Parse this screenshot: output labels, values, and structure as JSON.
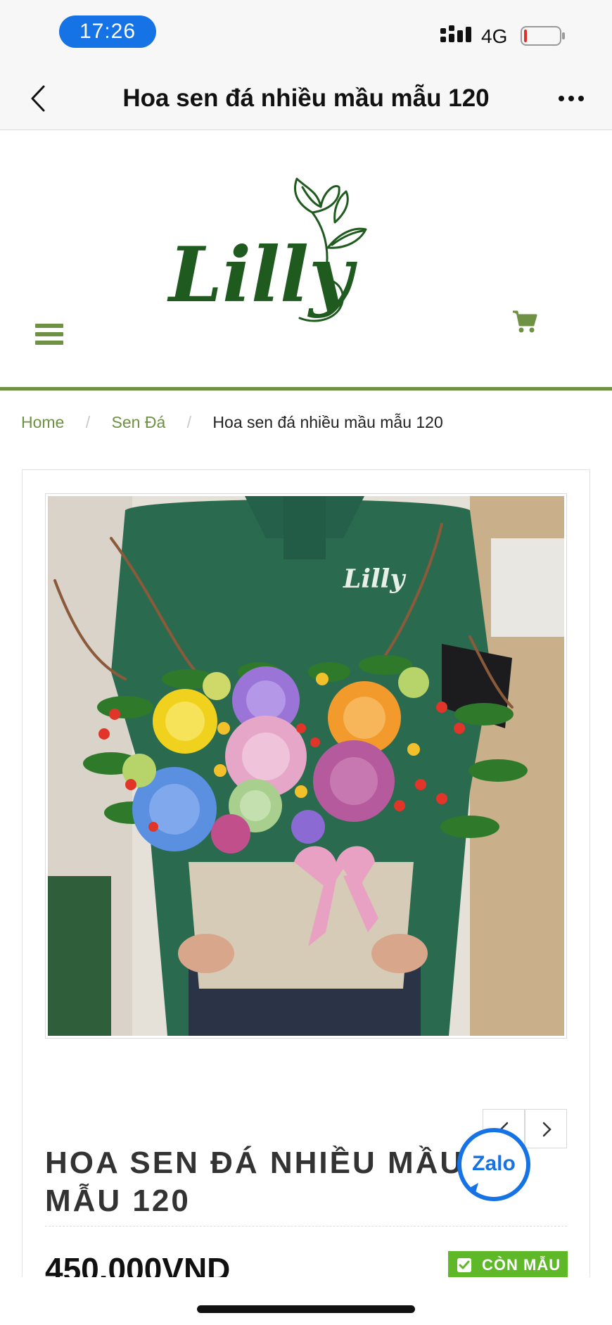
{
  "status_bar": {
    "time": "17:26",
    "network": "4G",
    "battery_level": 0.08,
    "battery_color": "#e0302a"
  },
  "nav": {
    "title": "Hoa sen đá nhiều mầu mẫu 120",
    "back_icon": "chevron-left-icon",
    "more_icon": "ellipsis-icon"
  },
  "header": {
    "logo_text": "Lilly",
    "menu_icon": "hamburger-menu-icon",
    "cart_icon": "shopping-cart-icon",
    "brand_color": "#1f5a1e",
    "accent_color": "#6e9143"
  },
  "breadcrumb": {
    "items": [
      "Home",
      "Sen Đá"
    ],
    "separator": "/",
    "current": "Hoa sen đá nhiều mầu mẫu 120"
  },
  "product": {
    "image_alt_icon": "flower-basket-photo",
    "title": "HOA SEN ĐÁ NHIỀU MẦU MẪU 120",
    "price": "450.000VND",
    "stock_label": "CÒN MẪU",
    "stock_color": "#5fb827"
  },
  "slider": {
    "prev_icon": "chevron-left-icon",
    "next_icon": "chevron-right-icon"
  },
  "zalo": {
    "label": "Zalo",
    "color": "#1673e6"
  }
}
